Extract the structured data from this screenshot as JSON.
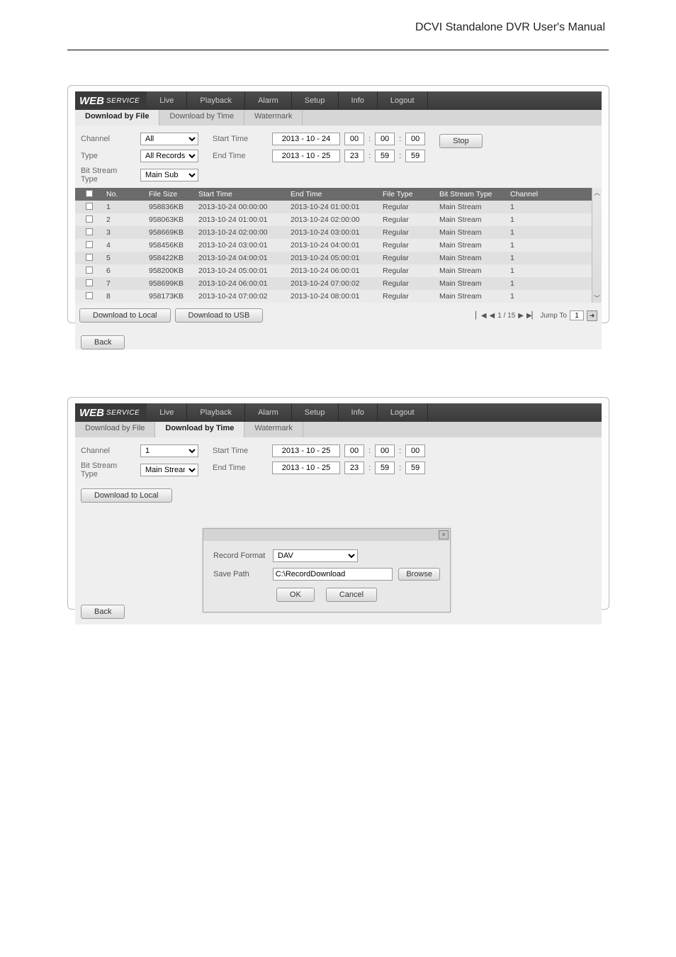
{
  "page_title": "DCVI Standalone DVR User's Manual",
  "brand": {
    "main": "WEB",
    "sub": "SERVICE"
  },
  "nav": [
    "Live",
    "Playback",
    "Alarm",
    "Setup",
    "Info",
    "Logout"
  ],
  "panel1": {
    "tabs": {
      "download_by_file": "Download by File",
      "download_by_time": "Download by Time",
      "watermark": "Watermark"
    },
    "form": {
      "channel_label": "Channel",
      "channel_value": "All",
      "type_label": "Type",
      "type_value": "All Records",
      "bitstream_label": "Bit Stream Type",
      "bitstream_value": "Main Sub",
      "start_time_label": "Start Time",
      "end_time_label": "End Time",
      "start_date": "2013 - 10 - 24",
      "start_h": "00",
      "start_m": "00",
      "start_s": "00",
      "end_date": "2013 - 10 - 25",
      "end_h": "23",
      "end_m": "59",
      "end_s": "59",
      "stop_btn": "Stop"
    },
    "table": {
      "headers": [
        "",
        "No.",
        "File Size",
        "Start Time",
        "End Time",
        "File Type",
        "Bit Stream Type",
        "Channel"
      ],
      "rows": [
        {
          "no": "1",
          "size": "958836KB",
          "start": "2013-10-24 00:00:00",
          "end": "2013-10-24 01:00:01",
          "type": "Regular",
          "stream": "Main Stream",
          "ch": "1"
        },
        {
          "no": "2",
          "size": "958063KB",
          "start": "2013-10-24 01:00:01",
          "end": "2013-10-24 02:00:00",
          "type": "Regular",
          "stream": "Main Stream",
          "ch": "1"
        },
        {
          "no": "3",
          "size": "958669KB",
          "start": "2013-10-24 02:00:00",
          "end": "2013-10-24 03:00:01",
          "type": "Regular",
          "stream": "Main Stream",
          "ch": "1"
        },
        {
          "no": "4",
          "size": "958456KB",
          "start": "2013-10-24 03:00:01",
          "end": "2013-10-24 04:00:01",
          "type": "Regular",
          "stream": "Main Stream",
          "ch": "1"
        },
        {
          "no": "5",
          "size": "958422KB",
          "start": "2013-10-24 04:00:01",
          "end": "2013-10-24 05:00:01",
          "type": "Regular",
          "stream": "Main Stream",
          "ch": "1"
        },
        {
          "no": "6",
          "size": "958200KB",
          "start": "2013-10-24 05:00:01",
          "end": "2013-10-24 06:00:01",
          "type": "Regular",
          "stream": "Main Stream",
          "ch": "1"
        },
        {
          "no": "7",
          "size": "958699KB",
          "start": "2013-10-24 06:00:01",
          "end": "2013-10-24 07:00:02",
          "type": "Regular",
          "stream": "Main Stream",
          "ch": "1"
        },
        {
          "no": "8",
          "size": "958173KB",
          "start": "2013-10-24 07:00:02",
          "end": "2013-10-24 08:00:01",
          "type": "Regular",
          "stream": "Main Stream",
          "ch": "1"
        }
      ]
    },
    "download_local_btn": "Download to Local",
    "download_usb_btn": "Download to USB",
    "pager": {
      "first": "▏◀",
      "prev": "◀",
      "text": "1 / 15",
      "next": "▶",
      "last": "▶▏",
      "jump_label": "Jump To",
      "jump_value": "1",
      "go": "➜"
    },
    "back_btn": "Back"
  },
  "panel2": {
    "tabs": {
      "download_by_file": "Download by File",
      "download_by_time": "Download by Time",
      "watermark": "Watermark"
    },
    "form": {
      "channel_label": "Channel",
      "channel_value": "1",
      "bitstream_label": "Bit Stream Type",
      "bitstream_value": "Main Stream",
      "start_time_label": "Start Time",
      "end_time_label": "End Time",
      "start_date": "2013 - 10 - 25",
      "start_h": "00",
      "start_m": "00",
      "start_s": "00",
      "end_date": "2013 - 10 - 25",
      "end_h": "23",
      "end_m": "59",
      "end_s": "59"
    },
    "download_local_btn": "Download to Local",
    "dialog": {
      "record_format_label": "Record Format",
      "record_format_value": "DAV",
      "save_path_label": "Save Path",
      "save_path_value": "C:\\RecordDownload",
      "browse_btn": "Browse",
      "ok_btn": "OK",
      "cancel_btn": "Cancel",
      "close": "×"
    },
    "back_btn": "Back"
  }
}
